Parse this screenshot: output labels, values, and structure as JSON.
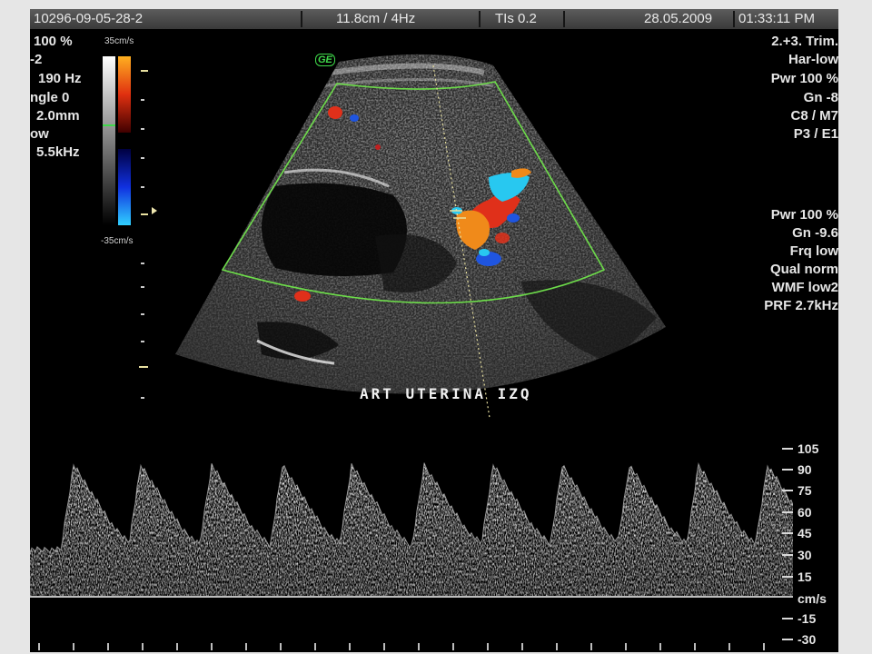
{
  "header": {
    "patient_id": "10296-09-05-28-2",
    "depth_freq": "11.8cm / 4Hz",
    "tis": "TIs 0.2",
    "date": "28.05.2009",
    "time": "01:33:11 PM"
  },
  "left_panel": {
    "lines": [
      "100 %",
      "-2",
      "190 Hz",
      "ngle 0",
      "2.0mm",
      "ow",
      "5.5kHz"
    ]
  },
  "color_scale": {
    "top_label": "35cm/s",
    "bottom_label": "-35cm/s"
  },
  "right_panel_top": [
    "2.+3. Trim.",
    "Har-low",
    "Pwr 100 %",
    "Gn -8",
    "C8 / M7",
    "P3 / E1"
  ],
  "right_panel_bottom": [
    "Pwr 100 %",
    "Gn -9.6",
    "Frq low",
    "Qual norm",
    "WMF low2",
    "PRF 2.7kHz"
  ],
  "image_logo": "GE",
  "annotation": "ART UTERINA IZQ",
  "doppler_scale": {
    "ticks": [
      "105",
      "90",
      "75",
      "60",
      "45",
      "30",
      "15",
      "cm/s",
      "-15",
      "-30"
    ]
  },
  "colors": {
    "roi_outline": "#6ddc4a",
    "flow_red": "#e0301a",
    "flow_blue": "#1f55e0",
    "flow_orange": "#f08a1a",
    "flow_cyan": "#28c8f0",
    "background": "#000000",
    "frame": "#e6e6e6"
  }
}
